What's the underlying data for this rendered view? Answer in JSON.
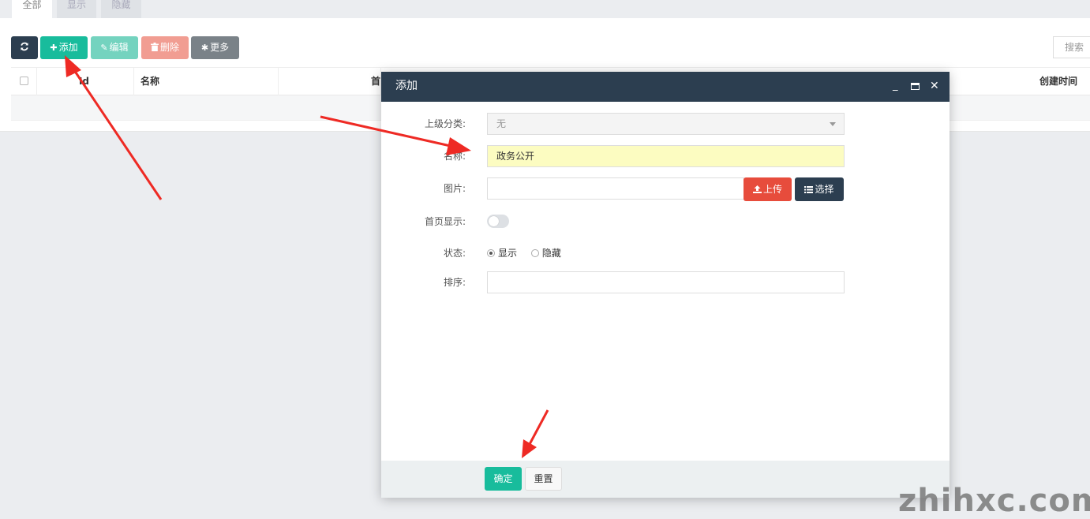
{
  "tabs": [
    {
      "label": "全部",
      "active": true
    },
    {
      "label": "显示",
      "active": false
    },
    {
      "label": "隐藏",
      "active": false
    }
  ],
  "toolbar": {
    "refresh_icon": "refresh-icon",
    "add_label": "添加",
    "edit_label": "编辑",
    "delete_label": "删除",
    "more_label": "更多"
  },
  "search": {
    "placeholder": "搜索"
  },
  "table": {
    "columns": {
      "id": "Id",
      "name": "名称",
      "home_partial": "首",
      "created": "创建时间"
    }
  },
  "modal": {
    "title": "添加",
    "fields": {
      "parent_label": "上级分类:",
      "parent_value": "无",
      "name_label": "名称:",
      "name_value": "政务公开",
      "image_label": "图片:",
      "image_value": "",
      "upload_label": "上传",
      "choose_label": "选择",
      "home_label": "首页显示:",
      "home_on": false,
      "status_label": "状态:",
      "status_options": [
        "显示",
        "隐藏"
      ],
      "status_selected": "显示",
      "sort_label": "排序:",
      "sort_value": ""
    },
    "footer": {
      "ok_label": "确定",
      "reset_label": "重置"
    }
  },
  "watermark": "zhihxc.com",
  "colors": {
    "primary": "#18bc9c",
    "dark": "#2c3e50",
    "danger": "#e74c3c",
    "annotation": "#ee2a24"
  }
}
